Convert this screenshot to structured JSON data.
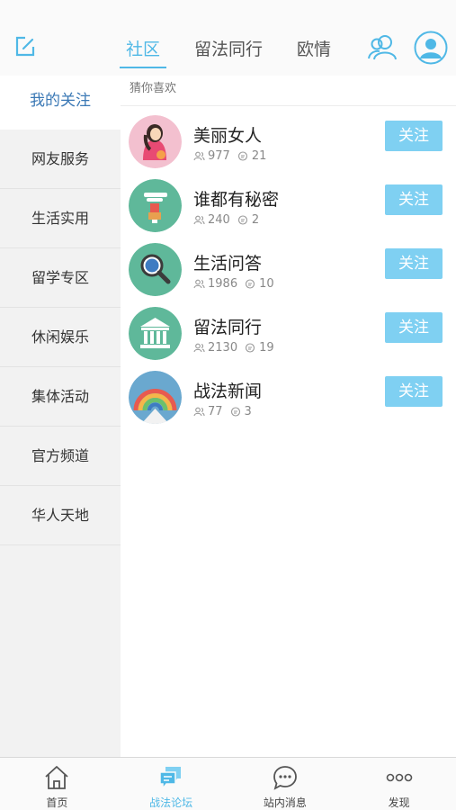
{
  "header": {
    "tabs": [
      {
        "label": "社区",
        "active": true
      },
      {
        "label": "留法同行",
        "active": false
      },
      {
        "label": "欧情",
        "active": false
      }
    ],
    "accent_color": "#4fb8e6"
  },
  "sidebar": {
    "items": [
      {
        "label": "我的关注",
        "active": true
      },
      {
        "label": "网友服务"
      },
      {
        "label": "生活实用"
      },
      {
        "label": "留学专区"
      },
      {
        "label": "休闲娱乐"
      },
      {
        "label": "集体活动"
      },
      {
        "label": "官方频道"
      },
      {
        "label": "华人天地"
      }
    ]
  },
  "main": {
    "section_title": "猜你喜欢",
    "follow_label": "关注",
    "forums": [
      {
        "name": "美丽女人",
        "members": "977",
        "posts": "21",
        "icon": "woman-portrait-icon"
      },
      {
        "name": "谁都有秘密",
        "members": "240",
        "posts": "2",
        "icon": "secret-box-icon"
      },
      {
        "name": "生活问答",
        "members": "1986",
        "posts": "10",
        "icon": "magnifier-icon"
      },
      {
        "name": "留法同行",
        "members": "2130",
        "posts": "19",
        "icon": "museum-icon"
      },
      {
        "name": "战法新闻",
        "members": "77",
        "posts": "3",
        "icon": "rainbow-icon"
      }
    ]
  },
  "bottom_nav": {
    "items": [
      {
        "label": "首页",
        "icon": "home-icon",
        "active": false
      },
      {
        "label": "战法论坛",
        "icon": "forum-chat-icon",
        "active": true
      },
      {
        "label": "站内消息",
        "icon": "message-bubble-icon",
        "active": false
      },
      {
        "label": "发现",
        "icon": "more-dots-icon",
        "active": false
      }
    ]
  }
}
